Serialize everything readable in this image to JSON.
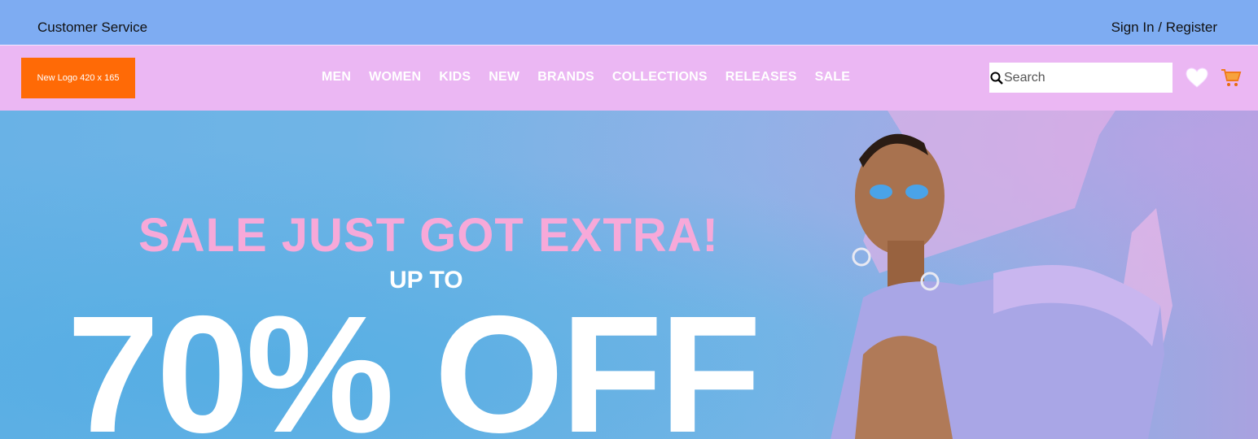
{
  "topbar": {
    "customer_service": "Customer Service",
    "sign_in": "Sign In / Register"
  },
  "logo": {
    "text": "New Logo 420 x 165"
  },
  "nav": {
    "items": [
      "MEN",
      "WOMEN",
      "KIDS",
      "NEW",
      "BRANDS",
      "COLLECTIONS",
      "RELEASES",
      "SALE"
    ]
  },
  "search": {
    "placeholder": "Search"
  },
  "icons": {
    "search": "search-icon",
    "wishlist": "heart-icon",
    "cart": "cart-icon"
  },
  "hero": {
    "headline": "SALE JUST GOT EXTRA!",
    "upto": "UP TO",
    "discount": "70% OFF"
  },
  "colors": {
    "topbar": "#7eacf2",
    "navbar": "#ebb7f3",
    "logo": "#ff6a06",
    "accent_pink": "#f7a9d9"
  }
}
